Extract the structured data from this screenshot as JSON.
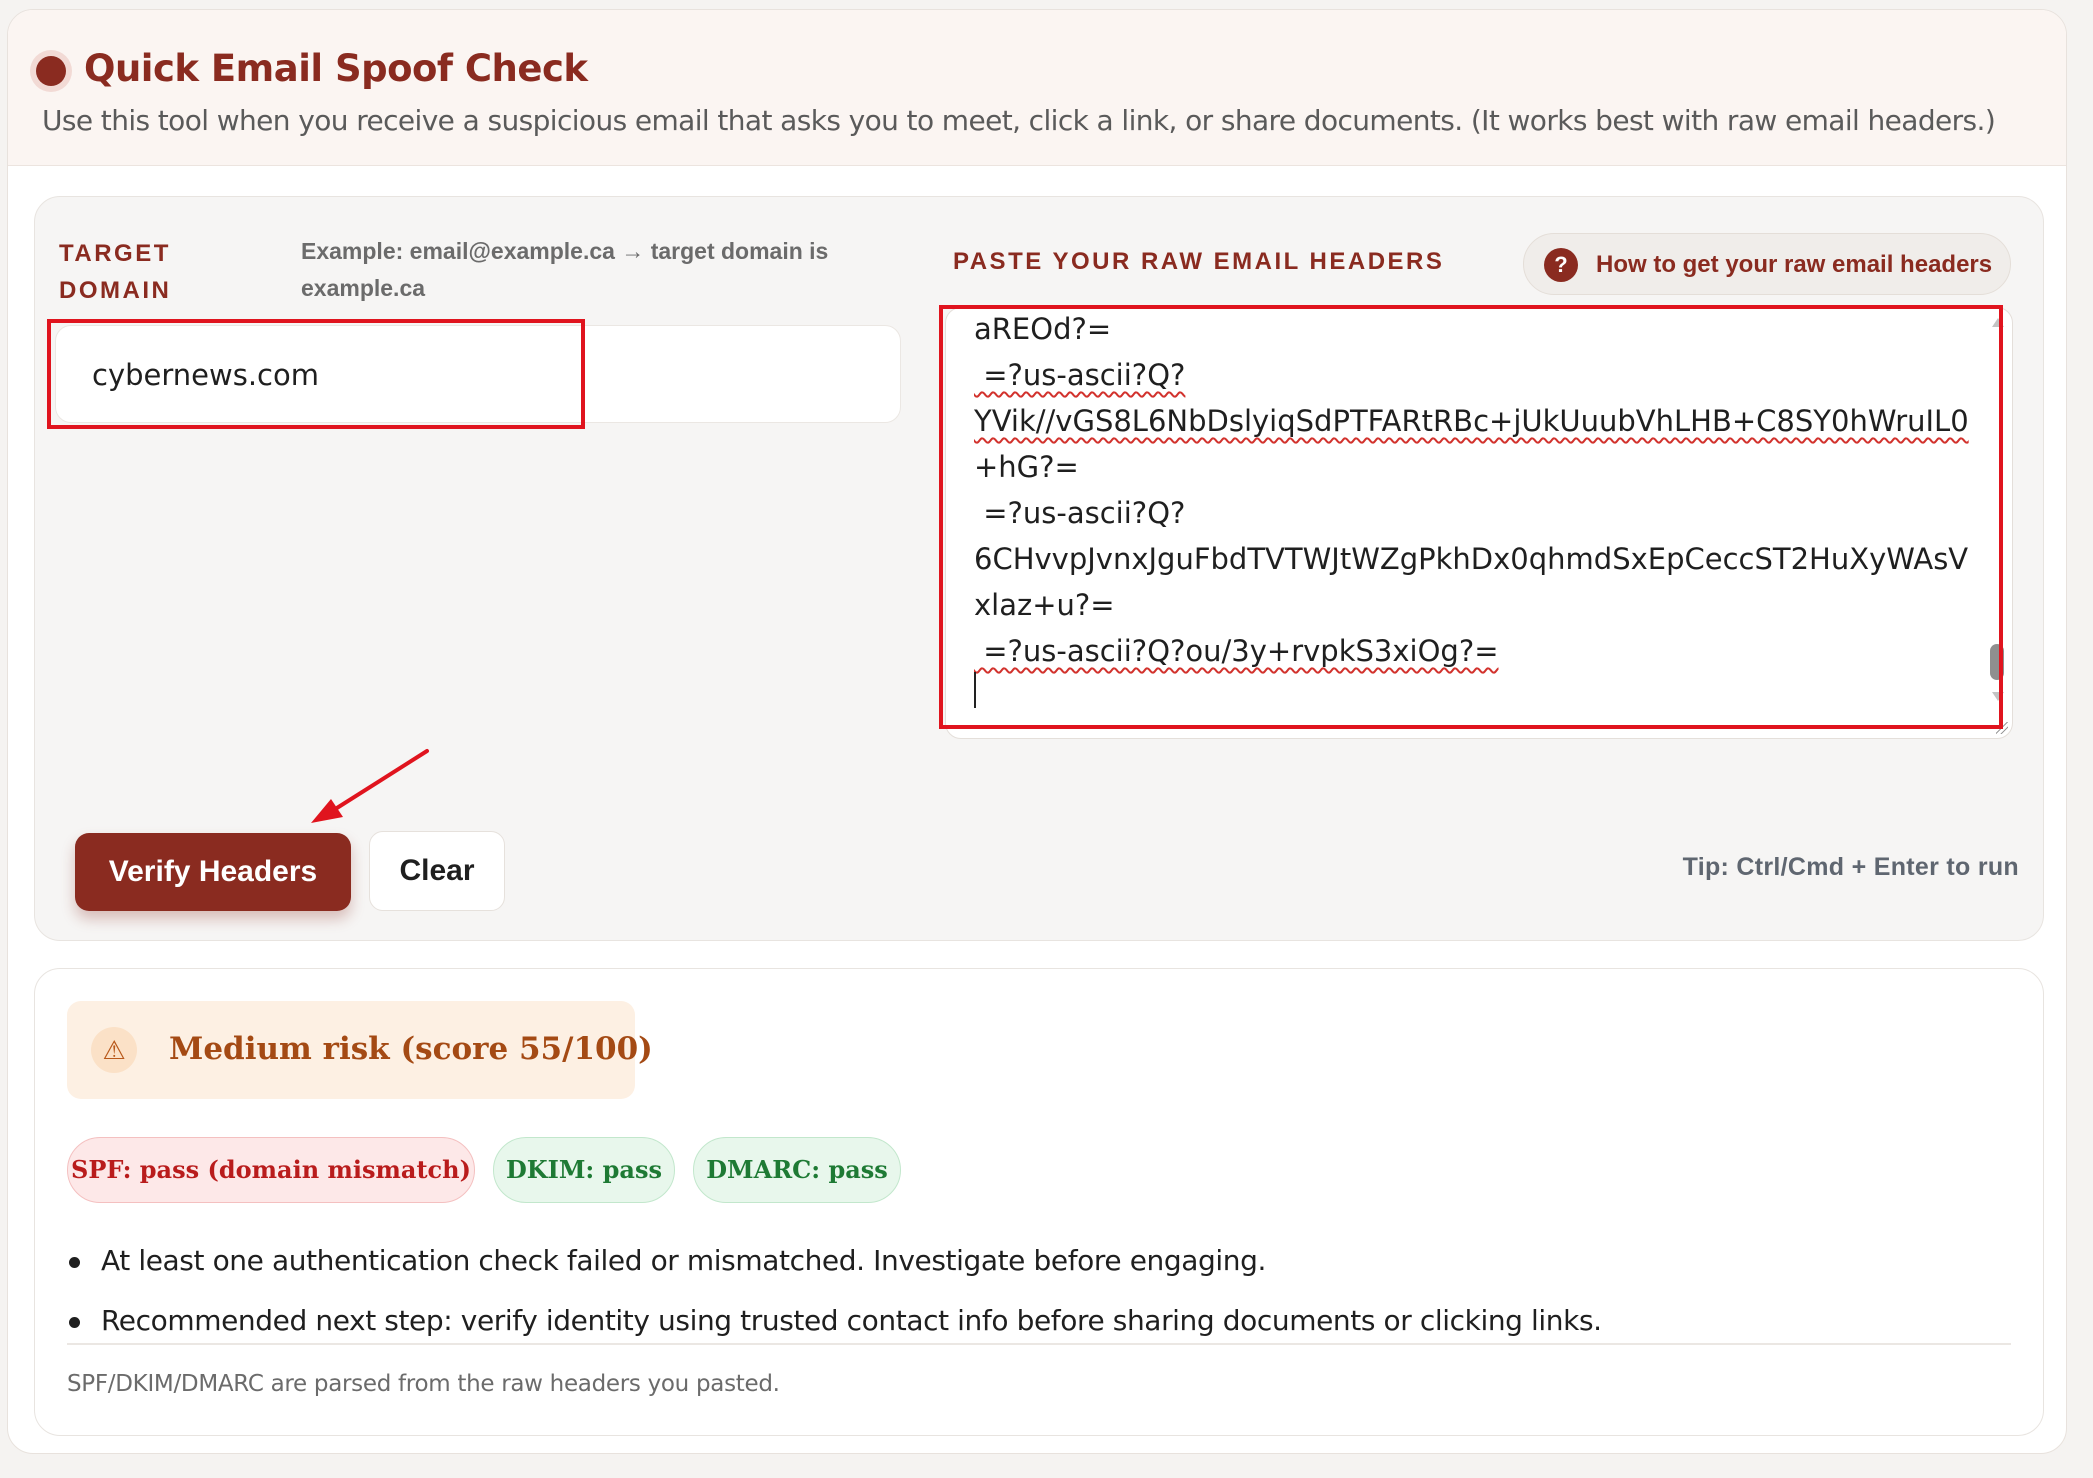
{
  "header": {
    "title": "Quick Email Spoof Check",
    "subtitle": "Use this tool when you receive a suspicious email that asks you to meet, click a link, or share documents. (It works best with raw email headers.)"
  },
  "form": {
    "target_domain_label": "Target Domain",
    "target_domain_hint": "Example: email@example.ca → target domain is example.ca",
    "target_domain_value": "cybernews.com",
    "headers_label": "Paste your raw email headers",
    "how_to_label": "How to get your raw email headers",
    "headers_lines": [
      "aREOd?=",
      " =?us-ascii?Q?",
      "YVik//vGS8L6NbDslyiqSdPTFARtRBc+jUkUuubVhLHB+C8SY0hWruIL0",
      "+hG?=",
      " =?us-ascii?Q?",
      "6CHvvpJvnxJguFbdTVTWJtWZgPkhDx0qhmdSxEpCeccST2HuXyWAsV",
      "xlaz+u?=",
      " =?us-ascii?Q?ou/3y+rvpkS3xiOg?="
    ],
    "verify_label": "Verify Headers",
    "clear_label": "Clear",
    "tip": "Tip: Ctrl/Cmd + Enter to run"
  },
  "results": {
    "risk_icon": "warning-triangle-icon",
    "risk_text": "Medium risk (score 55/100)",
    "risk_score": 55,
    "pills": {
      "spf": "SPF: pass (domain mismatch)",
      "dkim": "DKIM: pass",
      "dmarc": "DMARC: pass"
    },
    "bullets": [
      "At least one authentication check failed or mismatched. Investigate before engaging.",
      "Recommended next step: verify identity using trusted contact info before sharing documents or clicking links."
    ],
    "footnote": "SPF/DKIM/DMARC are parsed from the raw headers you pasted."
  },
  "colors": {
    "brand": "#8a2b20",
    "annotation_red": "#e0141e",
    "risk_orange": "#a44a14",
    "fail_red": "#b91c1c",
    "pass_green": "#1e7a34"
  }
}
